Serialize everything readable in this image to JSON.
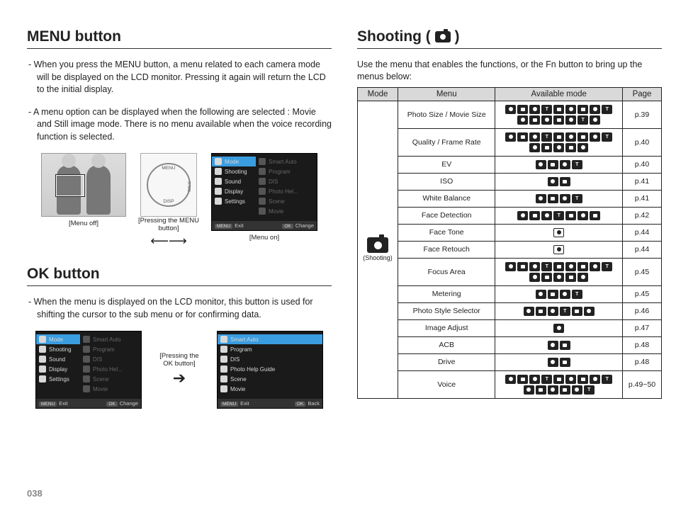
{
  "page_number": "038",
  "left": {
    "menu_button": {
      "heading": "MENU button",
      "para1": "- When you press the MENU button, a menu related to each camera mode will be displayed on the LCD monitor. Pressing it again will return the LCD to the initial display.",
      "para2": "- A menu option can be displayed when the following are selected : Movie and Still image mode. There is no menu available when the voice recording function is selected.",
      "press_label": "[Pressing the MENU button]",
      "cap_off": "[Menu off]",
      "cap_on": "[Menu on]",
      "dial_top": "MENU",
      "dial_right": "S.NIG",
      "dial_bottom": "DISP"
    },
    "ok_button": {
      "heading": "OK button",
      "para": "- When the menu is displayed on the LCD monitor, this button is used for shifting the cursor to the sub menu or for confirming data.",
      "press_label": "[Pressing the OK button]"
    },
    "lcd_menu": {
      "main_items": [
        "Mode",
        "Shooting",
        "Sound",
        "Display",
        "Settings"
      ],
      "sub_items": [
        "Smart Auto",
        "Program",
        "DIS",
        "Photo Help Guide",
        "Scene",
        "Movie"
      ],
      "sub_items_short": [
        "Smart Auto",
        "Program",
        "DIS",
        "Photo Hel...",
        "Scene",
        "Movie"
      ],
      "bar_exit": "Exit",
      "bar_change": "Change",
      "bar_back": "Back",
      "key_menu": "MENU",
      "key_ok": "OK"
    }
  },
  "right": {
    "heading_prefix": "Shooting ( ",
    "heading_suffix": " )",
    "intro": "Use the menu that enables the functions, or the Fn button to bring up the menus below:",
    "headers": {
      "mode": "Mode",
      "menu": "Menu",
      "avail": "Available mode",
      "page": "Page"
    },
    "mode_label": "(Shooting)",
    "rows": [
      {
        "menu": "Photo Size / Movie Size",
        "icons": 16,
        "page": "p.39"
      },
      {
        "menu": "Quality / Frame Rate",
        "icons": 14,
        "page": "p.40"
      },
      {
        "menu": "EV",
        "icons": 4,
        "page": "p.40"
      },
      {
        "menu": "ISO",
        "icons": 2,
        "page": "p.41"
      },
      {
        "menu": "White Balance",
        "icons": 4,
        "page": "p.41"
      },
      {
        "menu": "Face Detection",
        "icons": 7,
        "page": "p.42"
      },
      {
        "menu": "Face Tone",
        "icons": 1,
        "white": true,
        "page": "p.44"
      },
      {
        "menu": "Face Retouch",
        "icons": 1,
        "white": true,
        "page": "p.44"
      },
      {
        "menu": "Focus Area",
        "icons": 14,
        "page": "p.45"
      },
      {
        "menu": "Metering",
        "icons": 4,
        "page": "p.45"
      },
      {
        "menu": "Photo Style Selector",
        "icons": 6,
        "page": "p.46"
      },
      {
        "menu": "Image Adjust",
        "icons": 1,
        "page": "p.47"
      },
      {
        "menu": "ACB",
        "icons": 2,
        "page": "p.48"
      },
      {
        "menu": "Drive",
        "icons": 2,
        "page": "p.48"
      },
      {
        "menu": "Voice",
        "icons": 15,
        "page": "p.49~50"
      }
    ]
  }
}
